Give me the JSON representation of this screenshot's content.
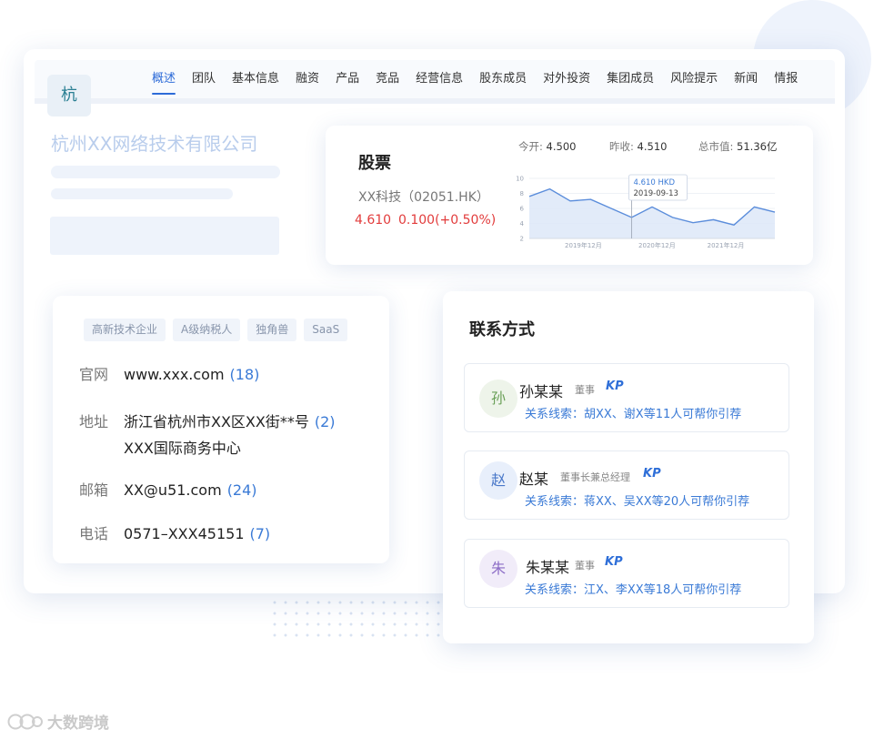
{
  "nav": {
    "tabs": [
      "概述",
      "团队",
      "基本信息",
      "融资",
      "产品",
      "竞品",
      "经营信息",
      "股东成员",
      "对外投资",
      "集团成员",
      "风险提示",
      "新闻",
      "情报"
    ],
    "active_index": 0
  },
  "company": {
    "logo_char": "杭",
    "name": "杭州XX网络技术有限公司"
  },
  "stock": {
    "title": "股票",
    "ticker": "XX科技（02051.HK）",
    "price": "4.610",
    "change": "0.100(+0.50%)",
    "open_label": "今开:",
    "open_value": "4.500",
    "prev_close_label": "昨收:",
    "prev_close_value": "4.510",
    "market_cap_label": "总市值:",
    "market_cap_value": "51.36亿",
    "tooltip_price": "4.610 HKD",
    "tooltip_date": "2019-09-13",
    "price_color": "#e23c3c"
  },
  "chart_data": {
    "type": "area",
    "x_tick_labels": [
      "2019年12月",
      "2020年12月",
      "2021年12月"
    ],
    "y_ticks": [
      2,
      4,
      6,
      8,
      10
    ],
    "ylim": [
      2,
      10
    ],
    "values": [
      7.6,
      8.6,
      7.0,
      7.2,
      6.0,
      4.8,
      6.2,
      4.8,
      4.1,
      4.5,
      3.8,
      6.2,
      5.5
    ],
    "highlight_index": 5,
    "grid": true
  },
  "info": {
    "tags": [
      "高新技术企业",
      "A级纳税人",
      "独角兽",
      "SaaS"
    ],
    "website_label": "官网",
    "website_value": "www.xxx.com",
    "website_count": "(18)",
    "address_label": "地址",
    "address_value": "浙江省杭州市XX区XX街**号",
    "address_count": "(2)",
    "address_line2": "XXX国际商务中心",
    "email_label": "邮箱",
    "email_value": "XX@u51.com",
    "email_count": "(24)",
    "phone_label": "电话",
    "phone_value": "0571–XXX45151",
    "phone_count": "(7)"
  },
  "contacts": {
    "title": "联系方式",
    "people": [
      {
        "avatar": "孙",
        "name": "孙某某",
        "role": "董事",
        "badge": "KP",
        "link": "关系线索：胡XX、谢X等11人可帮你引荐",
        "avatar_bg": "#eef4ea",
        "avatar_color": "#6aa058"
      },
      {
        "avatar": "赵",
        "name": "赵某",
        "role": "董事长兼总经理",
        "badge": "KP",
        "link": "关系线索：蒋XX、吴XX等20人可帮你引荐",
        "avatar_bg": "#e8effb",
        "avatar_color": "#4a78c9"
      },
      {
        "avatar": "朱",
        "name": "朱某某",
        "role": "董事",
        "badge": "KP",
        "link": "关系线索：江X、李XX等18人可帮你引荐",
        "avatar_bg": "#f1ecf9",
        "avatar_color": "#8c6cc6"
      }
    ]
  },
  "watermark": {
    "text": "大数跨境"
  }
}
